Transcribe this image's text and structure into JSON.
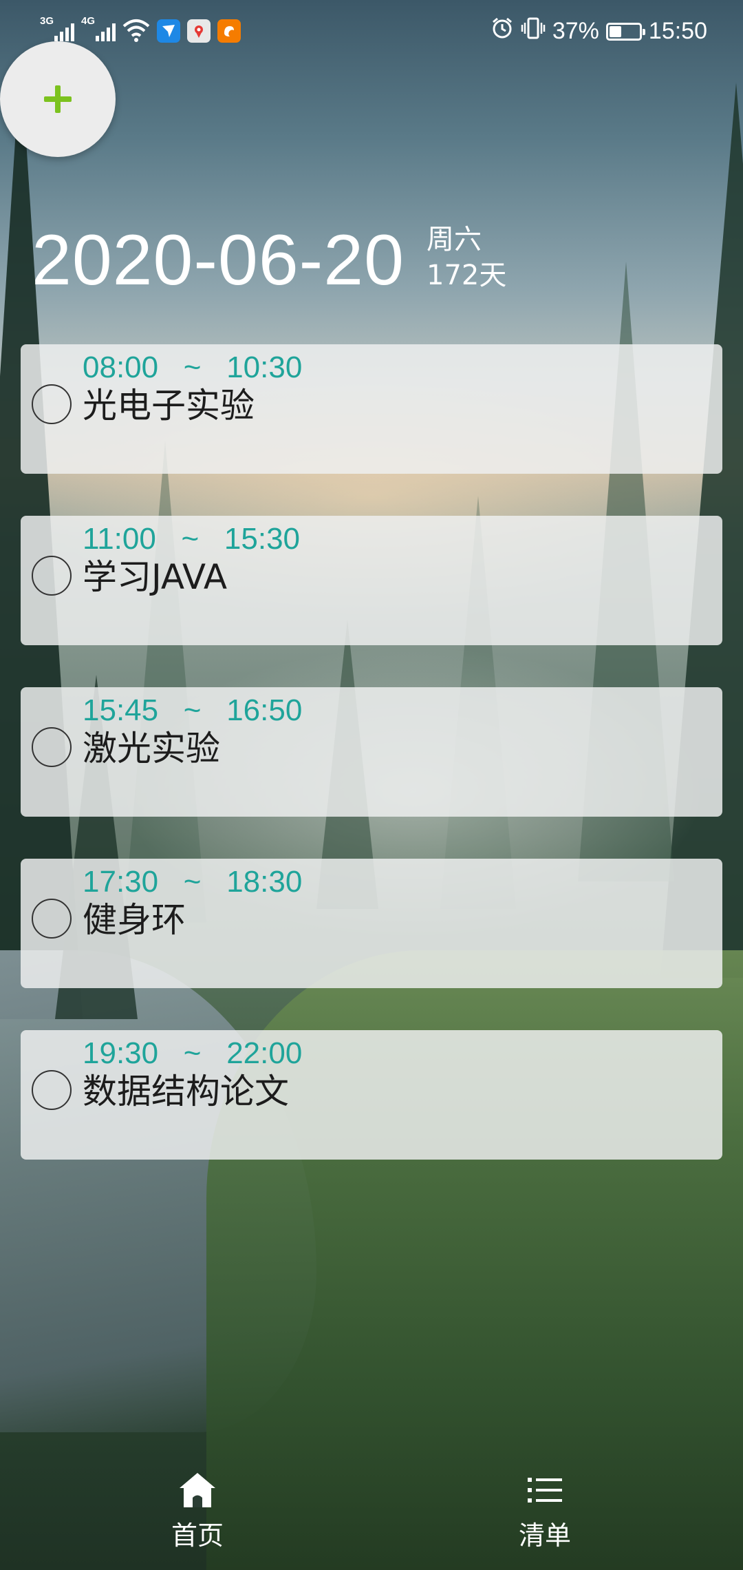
{
  "status_bar": {
    "sim1_network": "3G",
    "sim2_network": "4G",
    "wifi_badge": "4",
    "battery_percent": "37%",
    "battery_level": 0.37,
    "time": "15:50",
    "notification_icons": [
      "message-icon",
      "map-icon",
      "uc-browser-icon"
    ],
    "system_icons": [
      "alarm-icon",
      "vibrate-icon",
      "battery-icon"
    ]
  },
  "add_button": {
    "icon": "plus-icon",
    "color": "#7cc21f"
  },
  "header": {
    "date": "2020-06-20",
    "weekday": "周六",
    "day_count": "172天"
  },
  "tasks": [
    {
      "start": "08:00",
      "sep": "~",
      "end": "10:30",
      "title": "光电子实验",
      "done": false
    },
    {
      "start": "11:00",
      "sep": "~",
      "end": "15:30",
      "title": "学习JAVA",
      "done": false
    },
    {
      "start": "15:45",
      "sep": "~",
      "end": "16:50",
      "title": "激光实验",
      "done": false
    },
    {
      "start": "17:30",
      "sep": "~",
      "end": "18:30",
      "title": "健身环",
      "done": false
    },
    {
      "start": "19:30",
      "sep": "~",
      "end": "22:00",
      "title": "数据结构论文",
      "done": false
    }
  ],
  "bottom_nav": {
    "home": {
      "label": "首页",
      "icon": "home-icon"
    },
    "list": {
      "label": "清单",
      "icon": "list-icon"
    }
  },
  "colors": {
    "time_accent": "#1fa49a",
    "card_bg": "#eef0f0",
    "plus_green": "#7cc21f"
  }
}
